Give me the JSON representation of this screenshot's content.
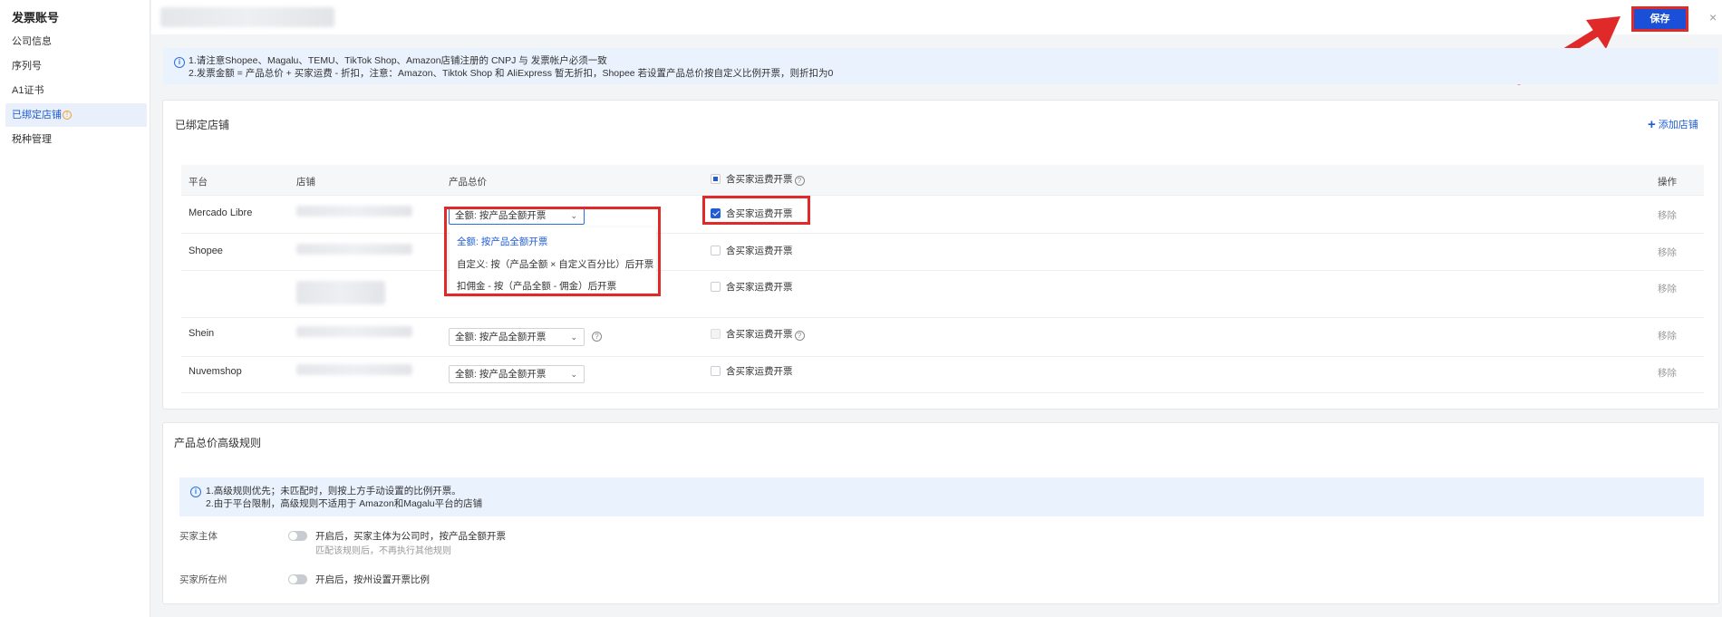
{
  "sidebar": {
    "title": "发票账号",
    "items": [
      {
        "label": "公司信息"
      },
      {
        "label": "序列号"
      },
      {
        "label": "A1证书"
      },
      {
        "label": "已绑定店铺"
      },
      {
        "label": "税种管理"
      }
    ],
    "warn_glyph": "!"
  },
  "toolbar": {
    "save_label": "保存",
    "close_glyph": "×"
  },
  "notice": {
    "line1": "1.请注意Shopee、Magalu、TEMU、TikTok Shop、Amazon店铺注册的 CNPJ 与 发票帐户必须一致",
    "line2": "2.发票金额 = 产品总价 + 买家运费 - 折扣，注意：Amazon、Tiktok Shop 和 AliExpress 暂无折扣，Shopee 若设置产品总价按自定义比例开票，则折扣为0"
  },
  "bound_stores": {
    "title": "已绑定店铺",
    "add_label": "添加店铺",
    "columns": {
      "platform": "平台",
      "store": "店铺",
      "product_total": "产品总价",
      "shipping": "含买家运费开票",
      "actions": "操作"
    },
    "rows": [
      {
        "platform": "Mercado Libre",
        "select": "全额: 按产品全额开票",
        "shipping": "含买家运费开票",
        "action": "移除"
      },
      {
        "platform": "Shopee",
        "shipping": "含买家运费开票",
        "action": "移除"
      },
      {
        "platform": "",
        "shipping": "含买家运费开票",
        "action": "移除"
      },
      {
        "platform": "Shein",
        "select": "全额: 按产品全额开票",
        "shipping": "含买家运费开票",
        "action": "移除"
      },
      {
        "platform": "Nuvemshop",
        "select": "全额: 按产品全额开票",
        "shipping": "含买家运费开票",
        "action": "移除"
      }
    ],
    "dropdown_options": [
      "全额: 按产品全额开票",
      "自定义: 按（产品全额 × 自定义百分比）后开票",
      "扣佣金 - 按（产品全额 - 佣金）后开票"
    ]
  },
  "advanced": {
    "title": "产品总价高级规则",
    "notice_line1": "1.高级规则优先；未匹配时，则按上方手动设置的比例开票。",
    "notice_line2": "2.由于平台限制，高级规则不适用于 Amazon和Magalu平台的店铺",
    "rules": [
      {
        "label": "买家主体",
        "text": "开启后，买家主体为公司时，按产品全额开票",
        "sub": "匹配该规则后，不再执行其他规则"
      },
      {
        "label": "买家所在州",
        "text": "开启后，按州设置开票比例"
      }
    ]
  },
  "icons": {
    "info": "i",
    "question": "?",
    "chevron": "⌄",
    "plus": "+"
  },
  "colors": {
    "primary": "#1f5cd6",
    "highlight_red": "#e02a2a",
    "notice_bg": "#eaf2fd"
  }
}
